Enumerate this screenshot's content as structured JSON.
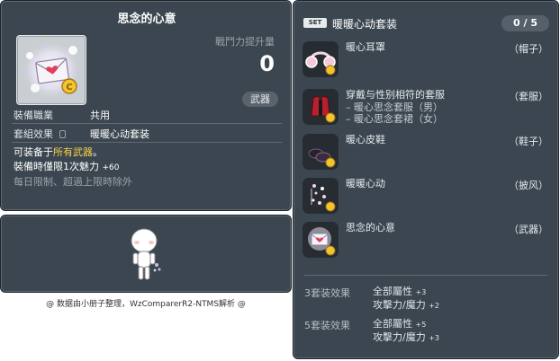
{
  "item_id": "01703052",
  "item": {
    "name": "思念的心意",
    "power_label": "戰鬥力提升量",
    "power_value": "0",
    "category_badge": "武器",
    "job_label": "裝備職業",
    "job_value": "共用",
    "set_label": "套組效果",
    "set_value": "暖暖心动套装",
    "equip_line_prefix": "可装备于",
    "equip_line_highlight": "所有武器",
    "equip_line_suffix": "。",
    "charm_label": "裝備時僅限1次魅力",
    "charm_value": "+60",
    "limit_note": "每日限制、超過上限時除外"
  },
  "footer": "@ 数据由小册子整理，WzComparerR2-NTMS解析 @",
  "set_panel": {
    "badge": "SET",
    "name": "暖暖心动套装",
    "count": "0 / 5",
    "pieces": [
      {
        "name": "暖心耳罩",
        "type": "（帽子）",
        "sub": []
      },
      {
        "name": "穿戴与性别相符的套服",
        "type": "（套服）",
        "sub": [
          "– 暖心思念套服（男）",
          "– 暖心思念套裙（女）"
        ]
      },
      {
        "name": "暖心皮鞋",
        "type": "（鞋子）",
        "sub": []
      },
      {
        "name": "暖暖心动",
        "type": "（披风）",
        "sub": []
      },
      {
        "name": "思念的心意",
        "type": "（武器）",
        "sub": []
      }
    ],
    "bonuses": [
      {
        "label": "3套装效果",
        "line1": "全部屬性",
        "val1": "+3",
        "line2": "攻擊力/魔力",
        "val2": "+2"
      },
      {
        "label": "5套装效果",
        "line1": "全部屬性",
        "val1": "+5",
        "line2": "攻擊力/魔力",
        "val2": "+3"
      }
    ]
  }
}
